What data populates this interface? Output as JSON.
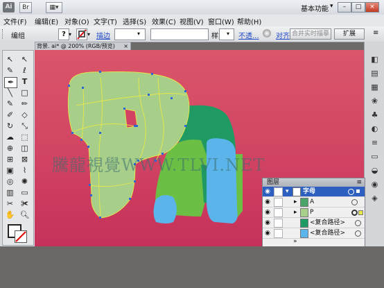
{
  "title_bar": {
    "app_logo": "Ai",
    "workspace": "基本功能",
    "window_buttons": [
      "–",
      "□",
      "×"
    ]
  },
  "menu": [
    "文件(F)",
    "编辑(E)",
    "对象(O)",
    "文字(T)",
    "选择(S)",
    "效果(C)",
    "视图(V)",
    "窗口(W)",
    "帮助(H)"
  ],
  "control_bar": {
    "selection_label": "编组",
    "stroke_label": "描边",
    "style_label": "样式:",
    "opacity_link": "不透...",
    "align_link": "对齐",
    "live_trace_button": "合并实时描摹",
    "expand_button": "扩展"
  },
  "document": {
    "tab_title": "背景. ai* @ 200% (RGB/预览)",
    "watermark": "騰龍視覺WWW.TLVI.NET"
  },
  "layers_panel": {
    "title": "图层",
    "rows": [
      {
        "name": "字母",
        "highlighted": true
      },
      {
        "name": "A",
        "highlighted": false
      },
      {
        "name": "P",
        "highlighted": false
      },
      {
        "name": "<复合路径>",
        "highlighted": false
      },
      {
        "name": "<复合路径>",
        "highlighted": false
      }
    ]
  },
  "colors": {
    "canvas": "#d24363",
    "selection_blue": "#2a66d6",
    "path_highlight": "#e8e848",
    "light_green": "#a7cf8a",
    "dark_green": "#1f9a63",
    "green": "#6bbf45",
    "light_blue": "#5bb4ea"
  }
}
